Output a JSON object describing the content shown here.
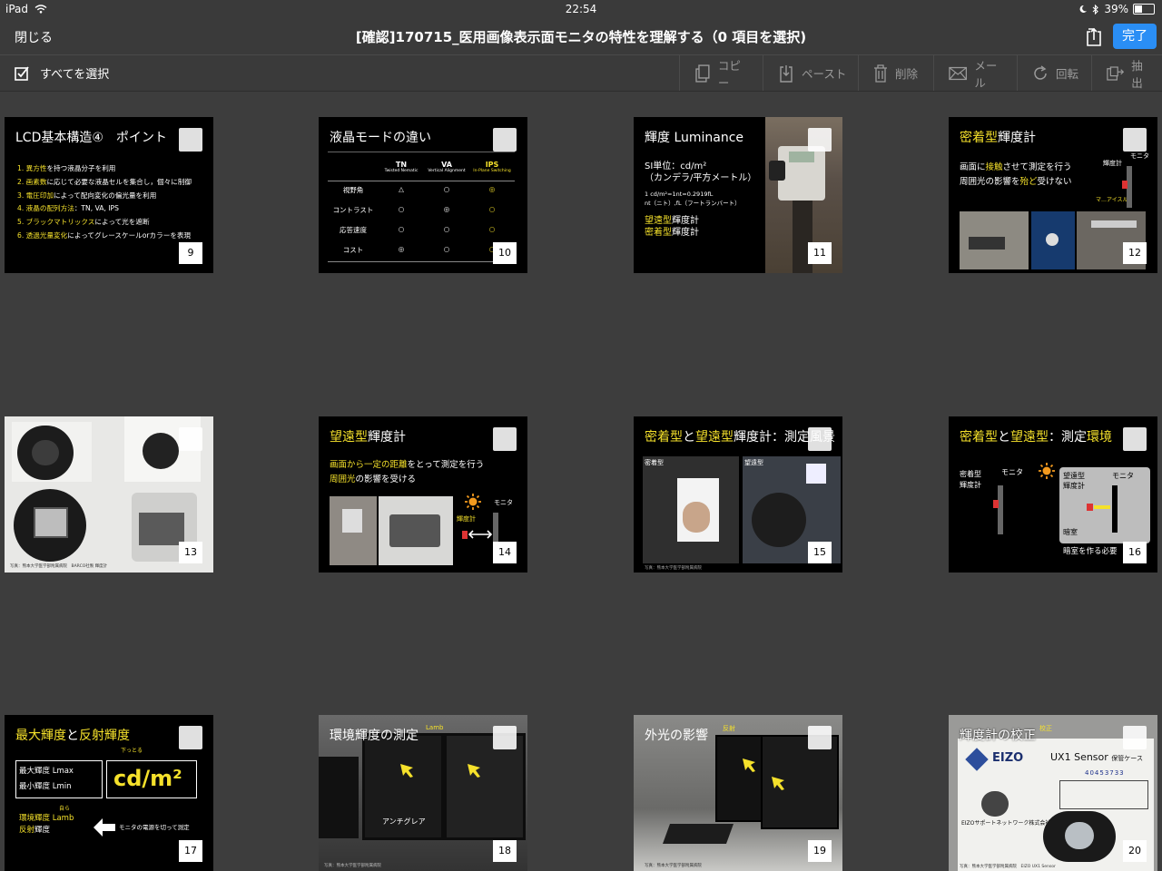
{
  "status": {
    "device": "iPad",
    "time": "22:54",
    "battery": "39%",
    "battery_level": 0.39
  },
  "nav": {
    "close_label": "閉じる",
    "title": "[確認]170715_医用画像表示面モニタの特性を理解する（0 項目を選択)",
    "done_label": "完了"
  },
  "toolbar": {
    "select_all_label": "すべてを選択",
    "actions": [
      {
        "label": "コピー",
        "icon": "copy-icon"
      },
      {
        "label": "ペースト",
        "icon": "paste-icon"
      },
      {
        "label": "削除",
        "icon": "trash-icon"
      },
      {
        "label": "メール",
        "icon": "mail-icon"
      },
      {
        "label": "回転",
        "icon": "rotate-icon"
      },
      {
        "label": "抽出",
        "icon": "extract-icon"
      }
    ]
  },
  "slides": {
    "s9": {
      "page": "9",
      "title": "LCD基本構造④　ポイント",
      "items": [
        {
          "n": "1.",
          "hl": "異方性",
          "rest": "を持つ液晶分子を利用"
        },
        {
          "n": "2.",
          "hl": "画素数",
          "rest": "に応じて必要な液晶セルを集合し，個々に制御"
        },
        {
          "n": "3.",
          "hl": "電圧印加",
          "rest": "によって配向変化の偏光量を利用"
        },
        {
          "n": "4.",
          "hl": "液晶の配列方法",
          "rest": "：TN, VA, IPS"
        },
        {
          "n": "5.",
          "hl": "ブラックマトリックス",
          "rest": "によって光を遮断"
        },
        {
          "n": "6.",
          "hl": "透過光量変化",
          "rest": "によってグレースケールorカラーを表現"
        }
      ]
    },
    "s10": {
      "page": "10",
      "title": "液晶モードの違い",
      "cols": [
        {
          "name": "TN",
          "sub": "Twisted Nematic"
        },
        {
          "name": "VA",
          "sub": "Vertical Alignment"
        },
        {
          "name": "IPS",
          "sub": "In-Plane Switching"
        }
      ],
      "rows": [
        {
          "label": "視野角",
          "vals": [
            "△",
            "○",
            "◎"
          ]
        },
        {
          "label": "コントラスト",
          "vals": [
            "○",
            "◎",
            "○"
          ]
        },
        {
          "label": "応答速度",
          "vals": [
            "○",
            "○",
            "○"
          ]
        },
        {
          "label": "コスト",
          "vals": [
            "◎",
            "○",
            "○"
          ]
        }
      ]
    },
    "s11": {
      "page": "11",
      "title": "輝度 Luminance",
      "unit_line": "SI単位：cd/m²",
      "unit_note": "（カンデラ/平方メートル）",
      "conv1": "1 cd/m²=1nt=0.2919fL",
      "conv2": "nt（ニト）,fL（フートランバート）",
      "telephoto_hl": "望遠型",
      "telephoto_rest": "輝度計",
      "contact_hl": "密着型",
      "contact_rest": "輝度計"
    },
    "s12": {
      "page": "12",
      "title_hl": "密着型",
      "title_rest": "輝度計",
      "line1a": "画面に",
      "line1hl": "接触",
      "line1b": "させて測定を行う",
      "line2a": "周囲光の影響を",
      "line2hl": "殆ど",
      "line2b": "受けない",
      "meter_label": "輝度計",
      "monitor_label": "モニタ",
      "handwrite": "マ…アイスル"
    },
    "s13": {
      "page": "13",
      "credit": "写真：熊本大学医学部附属病院　BARCO社製 輝度計"
    },
    "s14": {
      "page": "14",
      "title_hl": "望遠型",
      "title_rest": "輝度計",
      "line1hl": "画面から一定の距離",
      "line1b": "をとって測定を行う",
      "line2hl": "周囲光",
      "line2b": "の影響を受ける",
      "meter_label": "輝度計",
      "monitor_label": "モニタ"
    },
    "s15": {
      "page": "15",
      "title_hl1": "密着型",
      "title_mid": "と",
      "title_hl2": "望遠型",
      "title_rest": "輝度計：測定風景",
      "label_a": "密着型",
      "label_b": "望遠型",
      "credit": "写真：熊本大学医学部附属病院"
    },
    "s16": {
      "page": "16",
      "title_hl1": "密着型",
      "title_mid": "と",
      "title_hl2": "望遠型",
      "title_rest": "：測定",
      "title_hl3": "環境",
      "contact_label": "密着型\n輝度計",
      "monitor_label": "モニタ",
      "tele_label": "望遠型\n輝度計",
      "monitor_label2": "モニタ",
      "dark_label": "暗室",
      "note": "暗室を作る必要"
    },
    "s17": {
      "page": "17",
      "title_hl": "最大輝度",
      "title_mid": "と",
      "title_rest": "反射輝度",
      "lmax": "最大輝度 Lmax",
      "lmin": "最小輝度 Lmin",
      "unit": "cd/m²",
      "lamb_hl": "環境輝度",
      "lamb_rest": "Lamb",
      "refl_hl": "反射",
      "refl_rest": "輝度",
      "off_note": "モニタの電源を切って測定",
      "handwrite1": "下っとる",
      "handwrite2": "自ら"
    },
    "s18": {
      "page": "18",
      "title": "環境輝度の測定",
      "handwrite": "Lamb",
      "label": "アンチグレア",
      "credit": "写真：熊本大学医学部附属病院"
    },
    "s19": {
      "page": "19",
      "title": "外光の影響",
      "handwrite": "反射",
      "credit": "写真：熊本大学医学部附属病院"
    },
    "s20": {
      "page": "20",
      "title": "輝度計の校正",
      "handwrite": "校正",
      "brand": "EIZO",
      "sensor": "UX1 Sensor",
      "case_label": "保管ケース",
      "serial": "40453733",
      "company": "EIZOサポートネットワーク株式会社",
      "credit": "写真：熊本大学医学部附属病院　EIZO UX1 Sensor"
    }
  }
}
